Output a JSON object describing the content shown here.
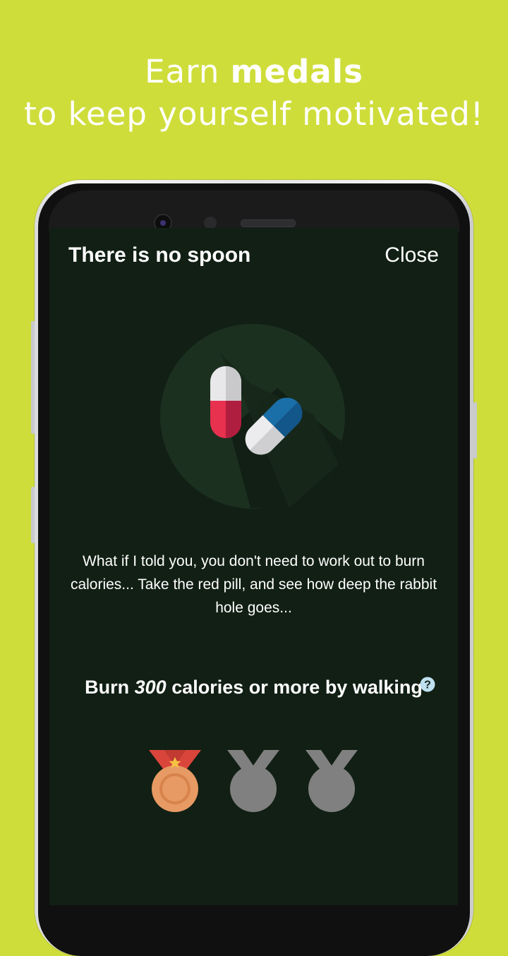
{
  "headline": {
    "line1_prefix": "Earn",
    "line1_bold": "medals",
    "line2": "to keep yourself motivated!"
  },
  "dialog": {
    "title": "There is no spoon",
    "close_label": "Close"
  },
  "achievement": {
    "description": "What if I told you, you don't need to work out to burn calories... Take the red pill, and see how deep the rabbit hole goes...",
    "goal_prefix": "Burn",
    "goal_value": "300",
    "goal_suffix": "calories or more by walking",
    "medals": [
      {
        "tier": "bronze",
        "earned": true
      },
      {
        "tier": "silver",
        "earned": false
      },
      {
        "tier": "gold",
        "earned": false
      }
    ]
  },
  "colors": {
    "background": "#cfdd3a",
    "screen_bg": "#111f14",
    "bronze": "#e79a63",
    "locked_medal": "#808080",
    "pill_red": "#e8304f",
    "pill_blue": "#1a6fa8",
    "help_icon": "#bfe0ef"
  },
  "icons": {
    "illustration": "pills-icon",
    "help": "help-circle-icon",
    "medal": "medal-icon"
  }
}
